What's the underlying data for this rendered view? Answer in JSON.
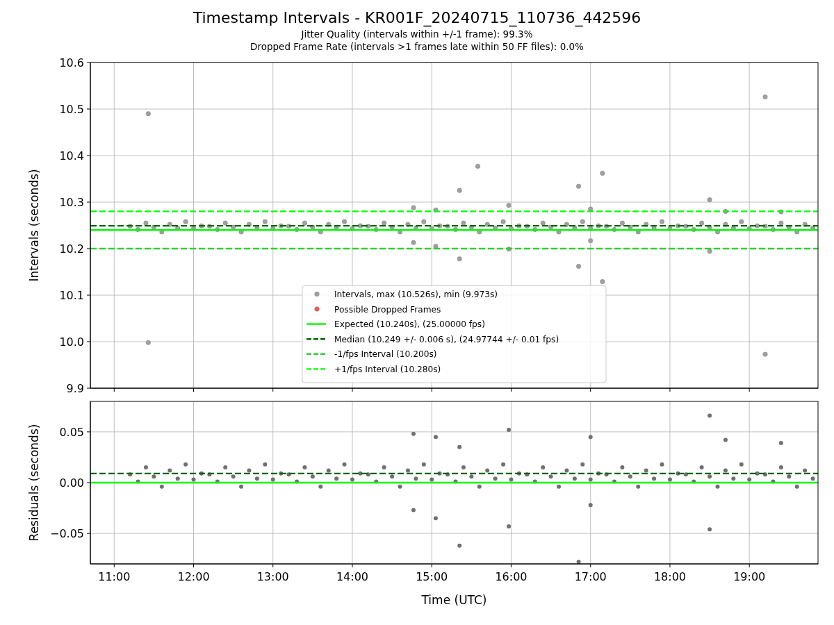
{
  "figure": {
    "title": "Timestamp Intervals - KR001F_20240715_110736_442596",
    "subtitles": [
      "Jitter Quality (intervals within +/-1 frame): 99.3%",
      "Dropped Frame Rate (intervals >1 frames late within 50 FF files): 0.0%"
    ]
  },
  "panels": [
    {
      "chart_data": {
        "type": "scatter",
        "ylabel": "Intervals (seconds)",
        "xlim": [
          10.7,
          19.865
        ],
        "ylim": [
          9.9,
          10.6
        ],
        "grid": true,
        "yticks": [
          {
            "value": 9.9,
            "label": "9.9"
          },
          {
            "value": 10.0,
            "label": "10.0"
          },
          {
            "value": 10.1,
            "label": "10.1"
          },
          {
            "value": 10.2,
            "label": "10.2"
          },
          {
            "value": 10.3,
            "label": "10.3"
          },
          {
            "value": 10.4,
            "label": "10.4"
          },
          {
            "value": 10.5,
            "label": "10.5"
          },
          {
            "value": 10.6,
            "label": "10.6"
          }
        ],
        "series": [
          {
            "name": "Intervals, max (10.526s), min (9.973s)",
            "color": "#a0a0a0",
            "x": [
              11.2,
              11.3,
              11.4,
              11.5,
              11.6,
              11.7,
              11.8,
              11.9,
              12.0,
              12.1,
              12.2,
              12.3,
              12.4,
              12.5,
              12.6,
              12.7,
              12.8,
              12.9,
              13.0,
              13.1,
              13.2,
              13.3,
              13.4,
              13.5,
              13.6,
              13.7,
              13.8,
              13.9,
              14.0,
              14.1,
              14.2,
              14.3,
              14.4,
              14.5,
              14.6,
              14.7,
              14.8,
              14.9,
              15.0,
              15.1,
              15.2,
              15.3,
              15.4,
              15.5,
              15.6,
              15.7,
              15.8,
              15.9,
              16.0,
              16.1,
              16.2,
              16.3,
              16.4,
              16.5,
              16.6,
              16.7,
              16.8,
              16.9,
              17.0,
              17.1,
              17.2,
              17.3,
              17.4,
              17.5,
              17.6,
              17.7,
              17.8,
              17.9,
              18.0,
              18.1,
              18.2,
              18.3,
              18.4,
              18.5,
              18.6,
              18.7,
              18.8,
              18.9,
              19.0,
              19.1,
              19.2,
              19.3,
              19.4,
              19.5,
              19.6,
              19.7,
              19.8,
              11.43,
              11.43,
              19.2,
              19.2,
              15.58,
              15.35,
              17.15,
              16.85,
              16.85,
              17.15,
              15.58,
              15.35,
              18.5,
              18.5,
              15.97,
              15.97,
              14.77,
              14.77,
              15.05,
              15.05,
              17.0,
              17.0,
              19.4,
              18.7
            ],
            "values": [
              10.248,
              10.241,
              10.255,
              10.246,
              10.236,
              10.252,
              10.244,
              10.258,
              10.243,
              10.249,
              10.248,
              10.241,
              10.255,
              10.246,
              10.236,
              10.252,
              10.244,
              10.258,
              10.243,
              10.249,
              10.248,
              10.241,
              10.255,
              10.246,
              10.236,
              10.252,
              10.244,
              10.258,
              10.243,
              10.249,
              10.248,
              10.241,
              10.255,
              10.246,
              10.236,
              10.252,
              10.244,
              10.258,
              10.243,
              10.249,
              10.248,
              10.241,
              10.255,
              10.246,
              10.236,
              10.252,
              10.244,
              10.258,
              10.243,
              10.249,
              10.248,
              10.241,
              10.255,
              10.246,
              10.236,
              10.252,
              10.244,
              10.258,
              10.243,
              10.249,
              10.248,
              10.241,
              10.255,
              10.246,
              10.236,
              10.252,
              10.244,
              10.258,
              10.243,
              10.249,
              10.248,
              10.241,
              10.255,
              10.246,
              10.236,
              10.252,
              10.244,
              10.258,
              10.243,
              10.249,
              10.248,
              10.241,
              10.255,
              10.246,
              10.236,
              10.252,
              10.244,
              10.49,
              9.998,
              10.526,
              9.973,
              10.377,
              10.325,
              10.362,
              10.334,
              10.162,
              10.129,
              10.11,
              10.178,
              10.305,
              10.194,
              10.293,
              10.199,
              10.288,
              10.213,
              10.283,
              10.205,
              10.285,
              10.217,
              10.279,
              10.28
            ]
          },
          {
            "name": "Possible Dropped Frames",
            "color": "#ff5050"
          }
        ],
        "ref_lines": [
          {
            "axis": "y",
            "value": 10.24,
            "color": "#00ff00",
            "label": "Expected (10.240s), (25.00000 fps)"
          },
          {
            "axis": "y",
            "value": 10.249,
            "color": "#006400",
            "label": "Median (10.249 +/- 0.006 s), (24.97744 +/- 0.01 fps)"
          },
          {
            "axis": "y",
            "value": 10.2,
            "color": "#32cd32",
            "label": "-1/fps Interval (10.200s)"
          },
          {
            "axis": "y",
            "value": 10.28,
            "color": "#00ff00",
            "label": "+1/fps Interval (10.280s)"
          }
        ],
        "legend": true
      }
    },
    {
      "chart_data": {
        "type": "scatter",
        "grid": true,
        "xlabel": "Time (UTC)",
        "ylabel": "Residuals (seconds)",
        "xlim": [
          10.7,
          19.865
        ],
        "ylim": [
          -0.08,
          0.08
        ],
        "xticks": [
          {
            "value": 11,
            "label": "11:00"
          },
          {
            "value": 12,
            "label": "12:00"
          },
          {
            "value": 13,
            "label": "13:00"
          },
          {
            "value": 14,
            "label": "14:00"
          },
          {
            "value": 15,
            "label": "15:00"
          },
          {
            "value": 16,
            "label": "16:00"
          },
          {
            "value": 17,
            "label": "17:00"
          },
          {
            "value": 18,
            "label": "18:00"
          },
          {
            "value": 19,
            "label": "19:00"
          }
        ],
        "yticks": [
          {
            "value": -0.05,
            "label": "−0.05"
          },
          {
            "value": 0,
            "label": "0.00"
          },
          {
            "value": 0.05,
            "label": "0.05"
          }
        ],
        "series": [
          {
            "color": "#707070",
            "x": [
              11.2,
              11.3,
              11.4,
              11.5,
              11.6,
              11.7,
              11.8,
              11.9,
              12.0,
              12.1,
              12.2,
              12.3,
              12.4,
              12.5,
              12.6,
              12.7,
              12.8,
              12.9,
              13.0,
              13.1,
              13.2,
              13.3,
              13.4,
              13.5,
              13.6,
              13.7,
              13.8,
              13.9,
              14.0,
              14.1,
              14.2,
              14.3,
              14.4,
              14.5,
              14.6,
              14.7,
              14.8,
              14.9,
              15.0,
              15.1,
              15.2,
              15.3,
              15.4,
              15.5,
              15.6,
              15.7,
              15.8,
              15.9,
              16.0,
              16.1,
              16.2,
              16.3,
              16.4,
              16.5,
              16.6,
              16.7,
              16.8,
              16.9,
              17.0,
              17.1,
              17.2,
              17.3,
              17.4,
              17.5,
              17.6,
              17.7,
              17.8,
              17.9,
              18.0,
              18.1,
              18.2,
              18.3,
              18.4,
              18.5,
              18.6,
              18.7,
              18.8,
              18.9,
              19.0,
              19.1,
              19.2,
              19.3,
              19.4,
              19.5,
              19.6,
              19.7,
              19.8,
              14.77,
              15.05,
              15.35,
              15.35,
              15.05,
              14.77,
              15.97,
              15.97,
              17.0,
              16.85,
              18.5,
              18.5,
              18.7,
              19.4,
              17.0
            ],
            "values": [
              0.008,
              0.001,
              0.015,
              0.006,
              -0.004,
              0.012,
              0.004,
              0.018,
              0.003,
              0.009,
              0.008,
              0.001,
              0.015,
              0.006,
              -0.004,
              0.012,
              0.004,
              0.018,
              0.003,
              0.009,
              0.008,
              0.001,
              0.015,
              0.006,
              -0.004,
              0.012,
              0.004,
              0.018,
              0.003,
              0.009,
              0.008,
              0.001,
              0.015,
              0.006,
              -0.004,
              0.012,
              0.004,
              0.018,
              0.003,
              0.009,
              0.008,
              0.001,
              0.015,
              0.006,
              -0.004,
              0.012,
              0.004,
              0.018,
              0.003,
              0.009,
              0.008,
              0.001,
              0.015,
              0.006,
              -0.004,
              0.012,
              0.004,
              0.018,
              0.003,
              0.009,
              0.008,
              0.001,
              0.015,
              0.006,
              -0.004,
              0.012,
              0.004,
              0.018,
              0.003,
              0.009,
              0.008,
              0.001,
              0.015,
              0.006,
              -0.004,
              0.012,
              0.004,
              0.018,
              0.003,
              0.009,
              0.008,
              0.001,
              0.015,
              0.006,
              -0.004,
              0.012,
              0.004,
              0.048,
              0.045,
              0.035,
              -0.062,
              -0.035,
              -0.027,
              0.052,
              -0.043,
              0.045,
              -0.078,
              0.066,
              -0.046,
              0.042,
              0.039,
              -0.022
            ]
          }
        ],
        "ref_lines": [
          {
            "axis": "y",
            "value": 0.009,
            "color": "#006400"
          },
          {
            "axis": "y",
            "value": 0,
            "color": "#00ff00"
          }
        ]
      }
    }
  ]
}
